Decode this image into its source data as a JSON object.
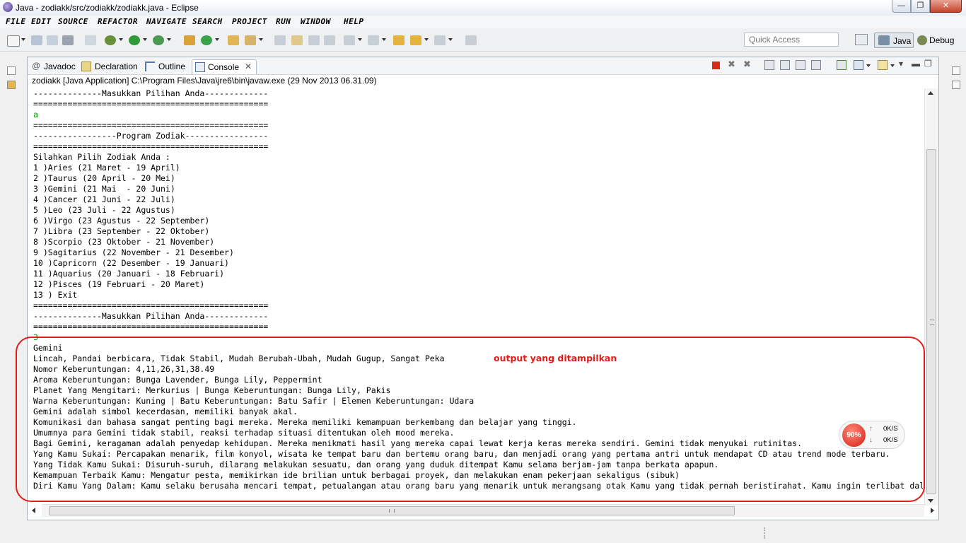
{
  "window": {
    "title": "Java - zodiakk/src/zodiakk/zodiakk.java - Eclipse",
    "minimize": "—",
    "maximize": "❐",
    "close": "✕"
  },
  "menu": [
    "FILE",
    "EDIT",
    "SOURCE",
    "REFACTOR",
    "NAVIGATE",
    "SEARCH",
    "PROJECT",
    "RUN",
    "WINDOW",
    "HELP"
  ],
  "toolbar": {
    "quick_access_placeholder": "Quick Access",
    "perspective_java": "Java",
    "perspective_debug": "Debug"
  },
  "tabs": [
    {
      "label": "Javadoc",
      "icon": "at-icon"
    },
    {
      "label": "Declaration",
      "icon": "declaration-icon"
    },
    {
      "label": "Outline",
      "icon": "outline-icon"
    },
    {
      "label": "Console",
      "icon": "console-icon",
      "active": true
    }
  ],
  "console": {
    "launch_label": "zodiakk [Java Application] C:\\Program Files\\Java\\jre6\\bin\\javaw.exe (29 Nov 2013 06.31.09)",
    "lines": [
      {
        "text": "--------------Masukkan Pilihan Anda-------------"
      },
      {
        "text": "================================================"
      },
      {
        "text": "a",
        "input": true
      },
      {
        "text": "================================================"
      },
      {
        "text": "-----------------Program Zodiak-----------------"
      },
      {
        "text": "================================================"
      },
      {
        "text": "Silahkan Pilih Zodiak Anda :"
      },
      {
        "text": "1 )Aries (21 Maret - 19 April)"
      },
      {
        "text": "2 )Taurus (20 April - 20 Mei)"
      },
      {
        "text": "3 )Gemini (21 Mai  - 20 Juni)"
      },
      {
        "text": "4 )Cancer (21 Juni - 22 Juli)"
      },
      {
        "text": "5 )Leo (23 Juli - 22 Agustus)"
      },
      {
        "text": "6 )Virgo (23 Agustus - 22 September)"
      },
      {
        "text": "7 )Libra (23 September - 22 Oktober)"
      },
      {
        "text": "8 )Scorpio (23 Oktober - 21 November)"
      },
      {
        "text": "9 )Sagitarius (22 November - 21 Desember)"
      },
      {
        "text": "10 )Capricorn (22 Desember - 19 Januari)"
      },
      {
        "text": "11 )Aquarius (20 Januari - 18 Februari)"
      },
      {
        "text": "12 )Pisces (19 Februari - 20 Maret)"
      },
      {
        "text": "13 ) Exit"
      },
      {
        "text": "================================================"
      },
      {
        "text": "--------------Masukkan Pilihan Anda-------------"
      },
      {
        "text": "================================================"
      },
      {
        "text": "3",
        "input": true
      },
      {
        "text": "Gemini"
      },
      {
        "text": "Lincah, Pandai berbicara, Tidak Stabil, Mudah Berubah-Ubah, Mudah Gugup, Sangat Peka"
      },
      {
        "text": "Nomor Keberuntungan: 4,11,26,31,38.49"
      },
      {
        "text": "Aroma Keberuntungan: Bunga Lavender, Bunga Lily, Peppermint"
      },
      {
        "text": "Planet Yang Mengitari: Merkurius | Bunga Keberuntungan: Bunga Lily, Pakis"
      },
      {
        "text": "Warna Keberuntungan: Kuning | Batu Keberuntungan: Batu Safir | Elemen Keberuntungan: Udara"
      },
      {
        "text": "Gemini adalah simbol kecerdasan, memiliki banyak akal."
      },
      {
        "text": "Komunikasi dan bahasa sangat penting bagi mereka. Mereka memiliki kemampuan berkembang dan belajar yang tinggi."
      },
      {
        "text": "Umumnya para Gemini tidak stabil, reaksi terhadap situasi ditentukan oleh mood mereka."
      },
      {
        "text": "Bagi Gemini, keragaman adalah penyedap kehidupan. Mereka menikmati hasil yang mereka capai lewat kerja keras mereka sendiri. Gemini tidak menyukai rutinitas."
      },
      {
        "text": "Yang Kamu Sukai: Percapakan menarik, film konyol, wisata ke tempat baru dan bertemu orang baru, dan menjadi orang yang pertama antri untuk mendapat CD atau trend mode terbaru."
      },
      {
        "text": "Yang Tidak Kamu Sukai: Disuruh-suruh, dilarang melakukan sesuatu, dan orang yang duduk ditempat Kamu selama berjam-jam tanpa berkata apapun."
      },
      {
        "text": "Kemampuan Terbaik Kamu: Mengatur pesta, memikirkan ide brilian untuk berbagai proyek, dan melakukan enam pekerjaan sekaligus (sibuk)"
      },
      {
        "text": "Diri Kamu Yang Dalam: Kamu selaku berusaha mencari tempat, petualangan atau orang baru yang menarik untuk merangsang otak Kamu yang tidak pernah beristirahat. Kamu ingin terlibat dalam"
      }
    ]
  },
  "annotation": {
    "text": "output yang ditampilkan",
    "color": "#e31b1b"
  },
  "net_widget": {
    "percent": "90%",
    "up_rate": "0K/S",
    "down_rate": "0K/S"
  },
  "colors": {
    "input_text": "#009900",
    "accent_red": "#e31b1b"
  }
}
